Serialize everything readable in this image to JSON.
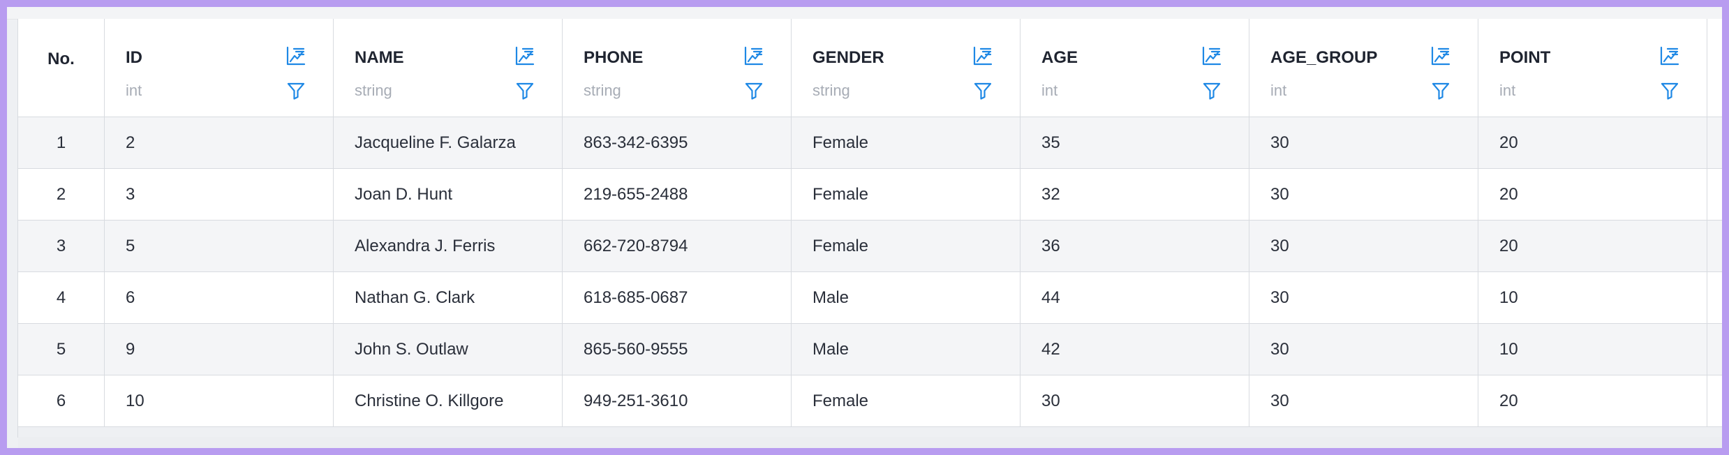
{
  "colors": {
    "accent": "#1e88e5",
    "frame": "#b89cf0"
  },
  "table": {
    "no_header": "No.",
    "columns": [
      {
        "name": "ID",
        "type": "int"
      },
      {
        "name": "NAME",
        "type": "string"
      },
      {
        "name": "PHONE",
        "type": "string"
      },
      {
        "name": "GENDER",
        "type": "string"
      },
      {
        "name": "AGE",
        "type": "int"
      },
      {
        "name": "AGE_GROUP",
        "type": "int"
      },
      {
        "name": "POINT",
        "type": "int"
      }
    ],
    "rows": [
      {
        "no": "1",
        "cells": [
          "2",
          "Jacqueline F. Galarza",
          "863-342-6395",
          "Female",
          "35",
          "30",
          "20"
        ]
      },
      {
        "no": "2",
        "cells": [
          "3",
          "Joan D. Hunt",
          "219-655-2488",
          "Female",
          "32",
          "30",
          "20"
        ]
      },
      {
        "no": "3",
        "cells": [
          "5",
          "Alexandra J. Ferris",
          "662-720-8794",
          "Female",
          "36",
          "30",
          "20"
        ]
      },
      {
        "no": "4",
        "cells": [
          "6",
          "Nathan G. Clark",
          "618-685-0687",
          "Male",
          "44",
          "30",
          "10"
        ]
      },
      {
        "no": "5",
        "cells": [
          "9",
          "John S. Outlaw",
          "865-560-9555",
          "Male",
          "42",
          "30",
          "10"
        ]
      },
      {
        "no": "6",
        "cells": [
          "10",
          "Christine O. Killgore",
          "949-251-3610",
          "Female",
          "30",
          "30",
          "20"
        ]
      }
    ]
  }
}
